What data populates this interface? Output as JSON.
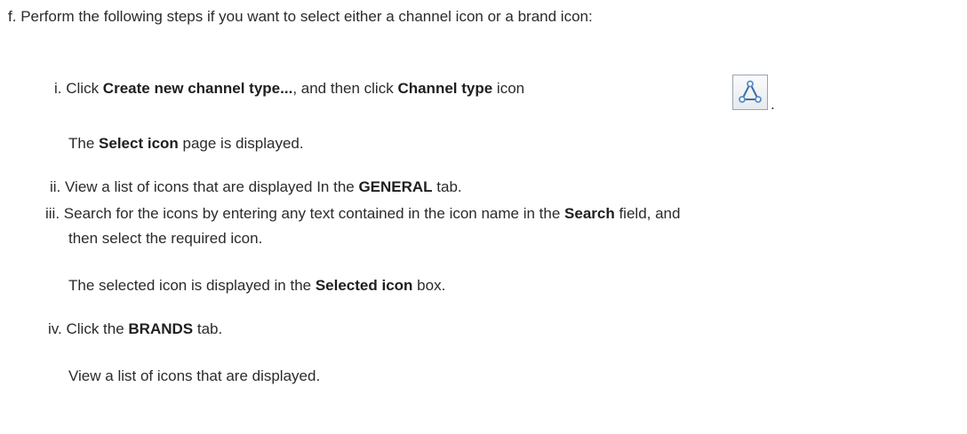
{
  "steps": {
    "f": {
      "marker": "f.",
      "text": "Perform the following steps if you want to select either a channel icon or a brand icon:"
    },
    "i": {
      "marker": "i.",
      "text_1": "Click ",
      "bold_1": "Create new channel type...",
      "text_2": ", and then click ",
      "bold_2": "Channel type",
      "text_3": " icon",
      "icon": "channel-type-icon",
      "trailing": ".",
      "result_prefix": "The ",
      "result_bold": "Select icon",
      "result_suffix": " page is displayed."
    },
    "ii": {
      "marker": "ii.",
      "text_1": "View a list of icons that are displayed In the ",
      "bold_1": "GENERAL",
      "text_2": " tab."
    },
    "iii": {
      "marker": "iii.",
      "text_1": "Search for the icons by entering any text contained in the icon name in the ",
      "bold_1": "Search",
      "text_2": " field, and",
      "text_3": "then select the required icon.",
      "result_prefix": "The selected icon is displayed in the ",
      "result_bold": "Selected icon",
      "result_suffix": " box."
    },
    "iv": {
      "marker": "iv.",
      "text_1": "Click the ",
      "bold_1": "BRANDS",
      "text_2": " tab.",
      "result": "View a list of icons that are displayed."
    }
  },
  "colors": {
    "text": "#2b2b2b",
    "icon_stroke": "#3a6ea5",
    "icon_node": "#5b8fc7"
  }
}
